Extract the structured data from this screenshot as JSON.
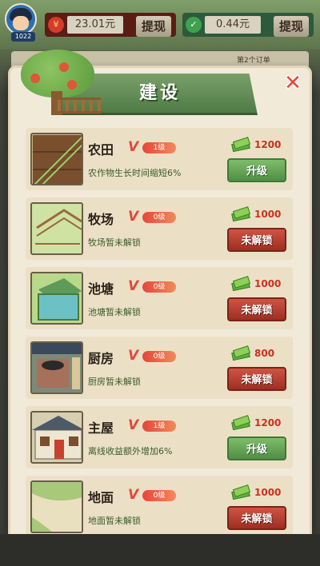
{
  "top_bar": {
    "player_level": "1022",
    "cash_red": {
      "value": "23.01元",
      "button": "提现"
    },
    "cash_green": {
      "value": "0.44元",
      "button": "提现"
    },
    "order_hint": "第2个订单"
  },
  "dialog": {
    "title": "建设",
    "close_icon": "close-icon"
  },
  "buildings": [
    {
      "name": "农田",
      "level": "1级",
      "desc": "农作物生长时间缩短6%",
      "cost": "1200",
      "action": "升级",
      "state": "upgrade",
      "thumb": "farmland"
    },
    {
      "name": "牧场",
      "level": "0级",
      "desc": "牧场暂未解锁",
      "cost": "1000",
      "action": "未解锁",
      "state": "locked",
      "thumb": "pasture"
    },
    {
      "name": "池塘",
      "level": "0级",
      "desc": "池塘暂未解锁",
      "cost": "1000",
      "action": "未解锁",
      "state": "locked",
      "thumb": "pond"
    },
    {
      "name": "厨房",
      "level": "0级",
      "desc": "厨房暂未解锁",
      "cost": "800",
      "action": "未解锁",
      "state": "locked",
      "thumb": "kitchen"
    },
    {
      "name": "主屋",
      "level": "1级",
      "desc": "离线收益额外增加6%",
      "cost": "1200",
      "action": "升级",
      "state": "upgrade",
      "thumb": "house"
    },
    {
      "name": "地面",
      "level": "0级",
      "desc": "地面暂未解锁",
      "cost": "1000",
      "action": "未解锁",
      "state": "locked",
      "thumb": "ground"
    }
  ],
  "colors": {
    "upgrade": "#5a9a4a",
    "locked": "#b53a2a",
    "banner": "#5e8a52"
  }
}
